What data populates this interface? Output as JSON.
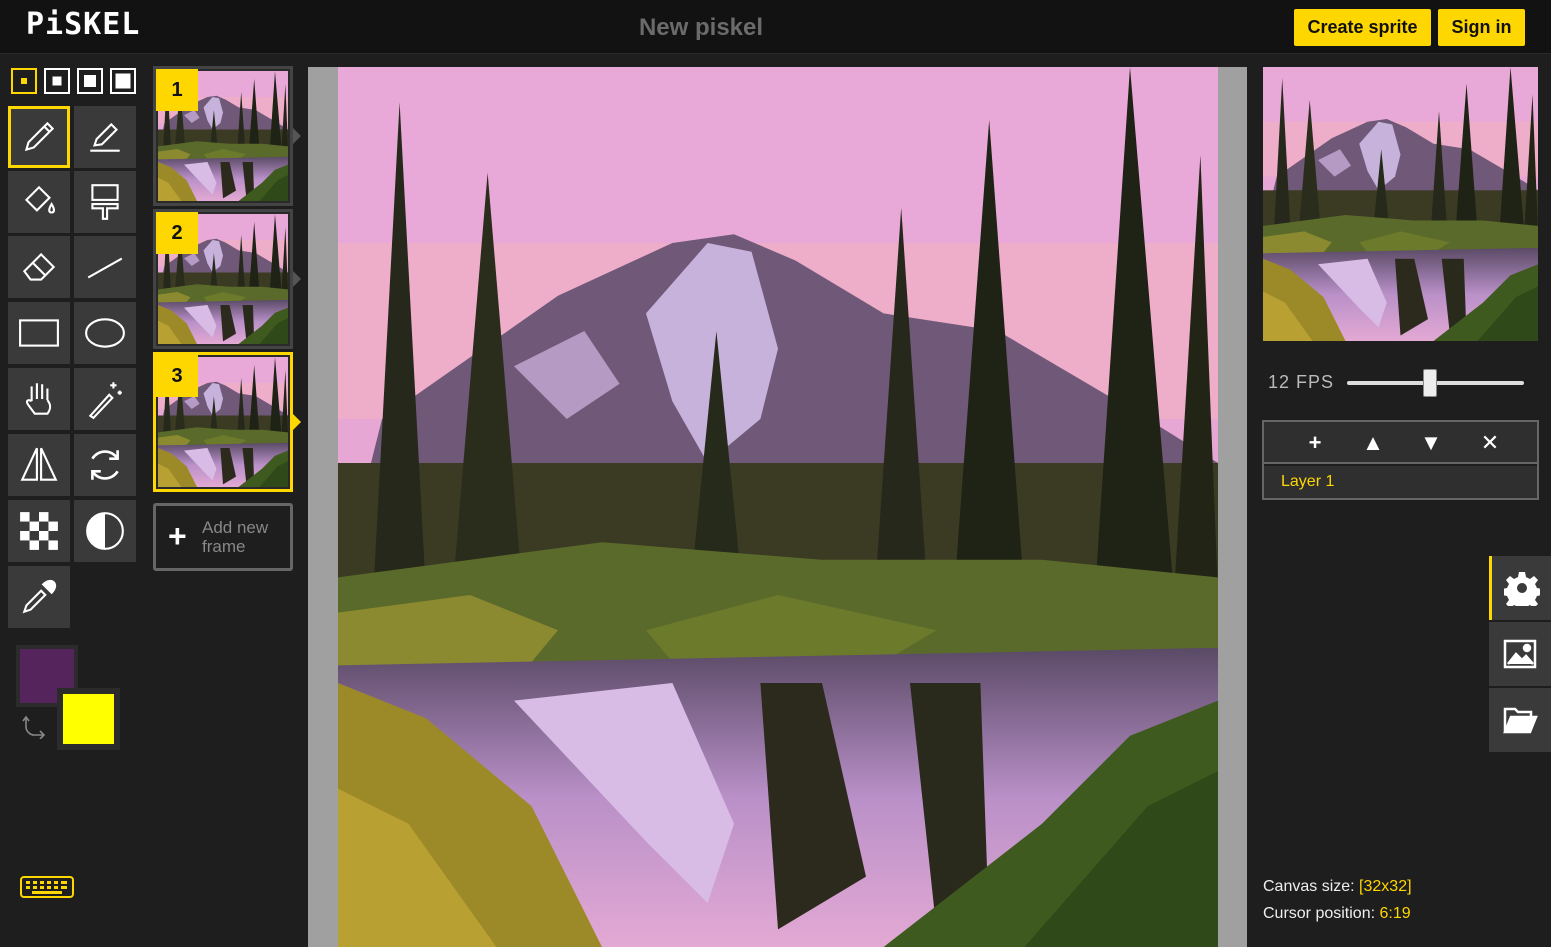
{
  "header": {
    "logo": "PiSKEL",
    "title": "New piskel",
    "create_sprite": "Create sprite",
    "sign_in": "Sign in"
  },
  "toolbox": {
    "pen_sizes": [
      "1",
      "2",
      "3",
      "4"
    ],
    "selected_pen_size": "1",
    "tools": [
      {
        "name": "pen-tool",
        "icon": "pencil-icon",
        "selected": true
      },
      {
        "name": "vertical-mirror-pen-tool",
        "icon": "mirror-pen-icon"
      },
      {
        "name": "paint-bucket-tool",
        "icon": "paint-bucket-icon"
      },
      {
        "name": "paint-all-same-color-tool",
        "icon": "paint-roller-icon"
      },
      {
        "name": "eraser-tool",
        "icon": "eraser-icon"
      },
      {
        "name": "stroke-tool",
        "icon": "line-icon"
      },
      {
        "name": "rectangle-tool",
        "icon": "rectangle-icon"
      },
      {
        "name": "ellipse-tool",
        "icon": "ellipse-icon"
      },
      {
        "name": "move-tool",
        "icon": "hand-icon"
      },
      {
        "name": "shape-selection-tool",
        "icon": "magic-wand-icon"
      },
      {
        "name": "rectangle-selection-tool",
        "icon": "flip-icon"
      },
      {
        "name": "lasso-selection-tool",
        "icon": "rotate-icon"
      },
      {
        "name": "lighten-tool",
        "icon": "checkerboard-icon"
      },
      {
        "name": "dithering-tool",
        "icon": "contrast-icon"
      },
      {
        "name": "color-picker-tool",
        "icon": "eyedropper-icon"
      }
    ],
    "primary_color": "#56245c",
    "secondary_color": "#ffff00"
  },
  "frames": {
    "items": [
      {
        "number": "1",
        "selected": false
      },
      {
        "number": "2",
        "selected": false
      },
      {
        "number": "3",
        "selected": true
      }
    ],
    "add_new": "Add new frame"
  },
  "preview": {
    "fps_value": "12",
    "fps_unit": "FPS",
    "fps_fraction": 0.47
  },
  "layers": {
    "items": [
      "Layer 1"
    ],
    "selected": "Layer 1"
  },
  "side_tabs": [
    "gear-icon",
    "image-icon",
    "folder-icon"
  ],
  "status": {
    "canvas_size_label": "Canvas size:",
    "canvas_size": "[32x32]",
    "cursor_label": "Cursor position:",
    "cursor": "6:19"
  },
  "colors": {
    "accent": "#ffd700",
    "header_bg": "#121212",
    "panel_bg": "#1e1e1e",
    "tool_bg": "#3a3a3a"
  }
}
